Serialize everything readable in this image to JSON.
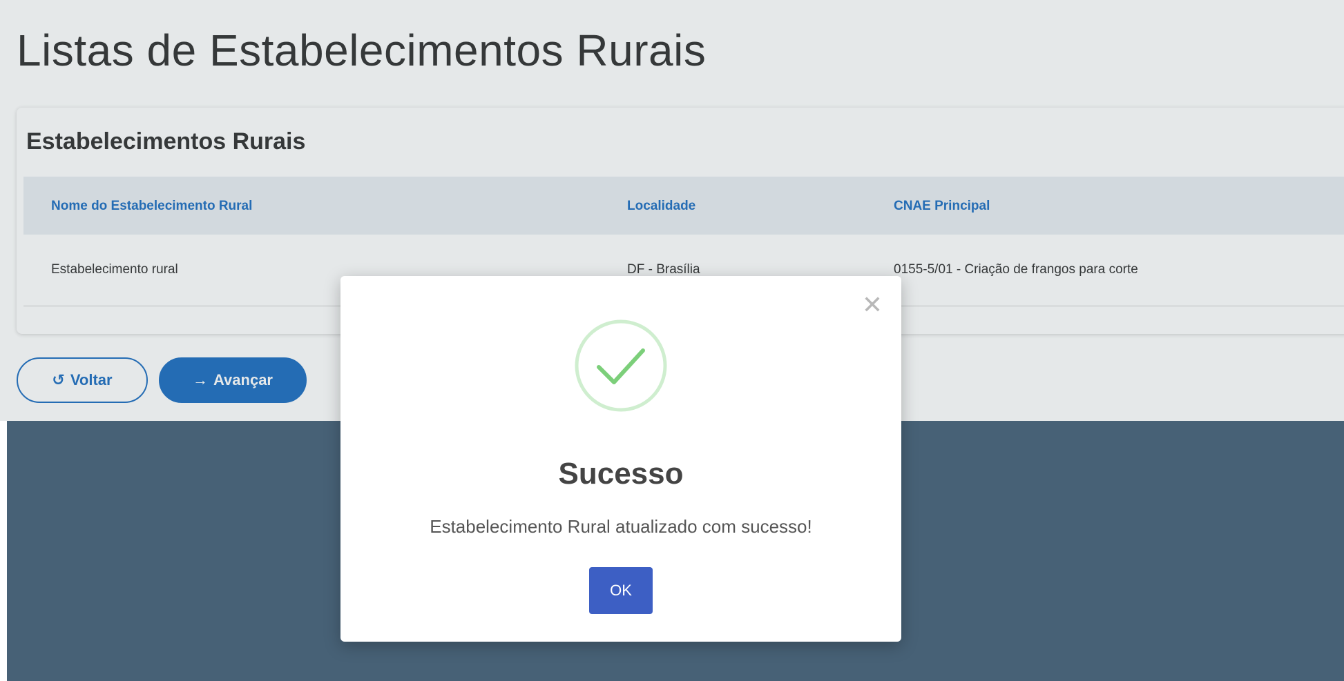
{
  "page": {
    "title": "Listas de Estabelecimentos Rurais"
  },
  "card": {
    "title": "Estabelecimentos Rurais",
    "columns": [
      "Nome do Estabelecimento Rural",
      "Localidade",
      "CNAE Principal"
    ],
    "rows": [
      {
        "name": "Estabelecimento rural",
        "locality": "DF - Brasília",
        "cnae": "0155-5/01 - Criação de frangos para corte"
      }
    ]
  },
  "actions": {
    "back_label": "Voltar",
    "back_icon": "undo-icon",
    "next_label": "Avançar",
    "next_icon": "arrow-right-icon"
  },
  "modal": {
    "close_icon": "close-icon",
    "status_icon": "checkmark-icon",
    "title": "Sucesso",
    "message": "Estabelecimento Rural atualizado com sucesso!",
    "ok_label": "OK"
  },
  "colors": {
    "primary": "#1f6fc2",
    "ok_button": "#3d5fc4",
    "success_green": "#7ccf7a",
    "overlay_dark": "#476176"
  }
}
